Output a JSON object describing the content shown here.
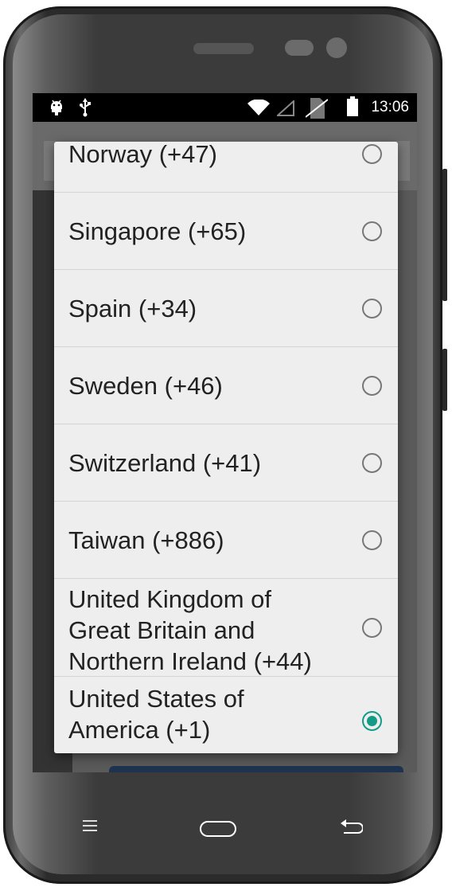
{
  "status_bar": {
    "time": "13:06",
    "left_icons": [
      "android-icon",
      "usb-icon"
    ],
    "right_icons": [
      "wifi-icon",
      "cell-signal-icon",
      "no-sim-icon",
      "battery-icon"
    ]
  },
  "country_dialog": {
    "options": [
      {
        "label": "Norway (+47)",
        "checked": false
      },
      {
        "label": "Singapore (+65)",
        "checked": false
      },
      {
        "label": "Spain (+34)",
        "checked": false
      },
      {
        "label": "Sweden (+46)",
        "checked": false
      },
      {
        "label": "Switzerland (+41)",
        "checked": false
      },
      {
        "label": "Taiwan (+886)",
        "checked": false
      },
      {
        "label": "United Kingdom of Great Britain and Northern Ireland (+44)",
        "checked": false
      },
      {
        "label": "United States of America (+1)",
        "checked": true
      }
    ],
    "accent_color": "#129c88"
  },
  "nav_bar": {
    "buttons": [
      "menu-icon",
      "home-icon",
      "back-icon"
    ]
  }
}
